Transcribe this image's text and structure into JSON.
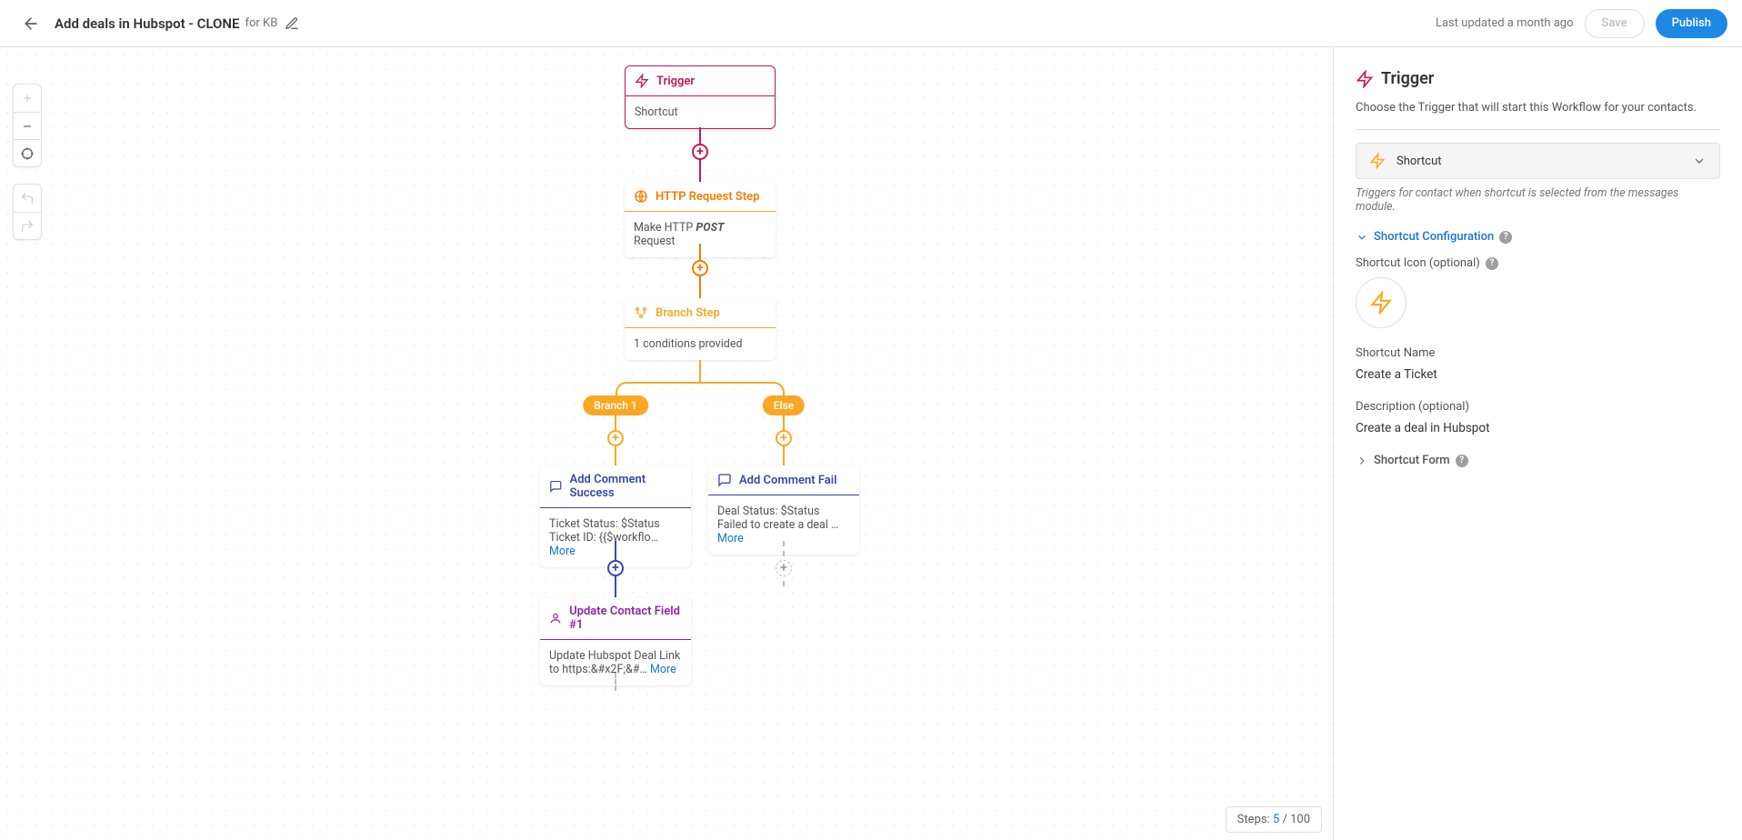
{
  "header": {
    "title": "Add deals in Hubspot - CLONE",
    "subtitle": "for KB",
    "last_updated": "Last updated a month ago",
    "save_label": "Save",
    "publish_label": "Publish"
  },
  "canvas": {
    "nodes": {
      "trigger": {
        "title": "Trigger",
        "body": "Shortcut"
      },
      "http": {
        "title": "HTTP Request Step",
        "body_pre": "Make HTTP ",
        "body_strong": "POST",
        "body_post": " Request"
      },
      "branch": {
        "title": "Branch Step",
        "body": "1 conditions provided"
      },
      "comment_ok": {
        "title": "Add Comment Success",
        "body": "Ticket Status: $Status Ticket ID: {{$workflo… ",
        "more": "More"
      },
      "comment_no": {
        "title": "Add Comment Fail",
        "body": "Deal Status: $Status Failed to create a deal … ",
        "more": "More"
      },
      "ucf": {
        "title": "Update Contact Field #1",
        "body": "Update Hubspot Deal Link to https:&#x2F;&#… ",
        "more": "More"
      }
    },
    "branches": {
      "branch1": "Branch 1",
      "else": "Else"
    },
    "steps": {
      "label": "Steps:",
      "current": "5",
      "max": "100"
    },
    "colors": {
      "magenta": "#c2185b",
      "orange": "#f57c00",
      "amber": "#f9a825",
      "indigo": "#3949ab",
      "purple": "#8e24aa",
      "grey": "#9e9e9e"
    }
  },
  "panel": {
    "heading": "Trigger",
    "description": "Choose the Trigger that will start this Workflow for your contacts.",
    "selected": "Shortcut",
    "hint": "Triggers for contact when shortcut is selected from the messages module.",
    "sections": {
      "config": "Shortcut Configuration",
      "icon_label": "Shortcut Icon (optional)",
      "name_label": "Shortcut Name",
      "name_value": "Create a Ticket",
      "desc_label": "Description (optional)",
      "desc_value": "Create a deal in Hubspot",
      "form": "Shortcut Form"
    }
  }
}
